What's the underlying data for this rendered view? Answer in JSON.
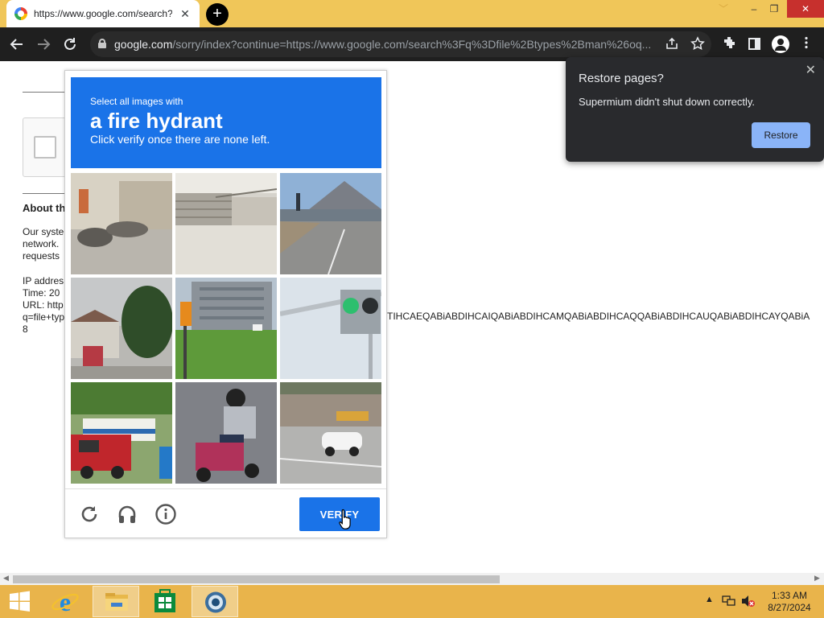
{
  "browser": {
    "tab_title": "https://www.google.com/search?q=file+types+man",
    "tab_close": "✕",
    "new_tab": "+",
    "url_host": "google.com",
    "url_rest": "/sorry/index?continue=https://www.google.com/search%3Fq%3Dfile%2Btypes%2Bman%26oq...",
    "window_controls": {
      "chevron": "﹀",
      "minimize": "–",
      "maximize": "❐",
      "close": "✕"
    }
  },
  "page": {
    "about_title": "About th",
    "para1": [
      "Our syste",
      "network.",
      "requests"
    ],
    "para2": [
      "IP addres",
      "Time: 20",
      "URL: http",
      "q=file+typ",
      "8"
    ],
    "long_code": "TIHCAEQABiABDIHCAIQABiABDIHCAMQABiABDIHCAQQABiABDIHCAUQABiABDIHCAYQABiA"
  },
  "captcha": {
    "prompt_small": "Select all images with",
    "prompt_big": "a fire hydrant",
    "instruction": "Click verify once there are none left.",
    "verify_label": "VERIFY",
    "tiles": [
      "street-with-bicycles",
      "stairs-and-pavement",
      "road-and-mountain",
      "house-and-tree",
      "building-and-traffic-light",
      "traffic-light",
      "red-van-and-bus",
      "scooter-rider",
      "white-car-on-road"
    ]
  },
  "restore_popup": {
    "title": "Restore pages?",
    "message": "Supermium didn't shut down correctly.",
    "button": "Restore",
    "close": "✕"
  },
  "taskbar": {
    "time": "1:33 AM",
    "date": "8/27/2024"
  },
  "colors": {
    "accent": "#1a73e8",
    "titlebar": "#f0c659",
    "taskbar": "#e9b44b",
    "popup_bg": "#292a2d",
    "popup_button": "#8ab4f8"
  }
}
